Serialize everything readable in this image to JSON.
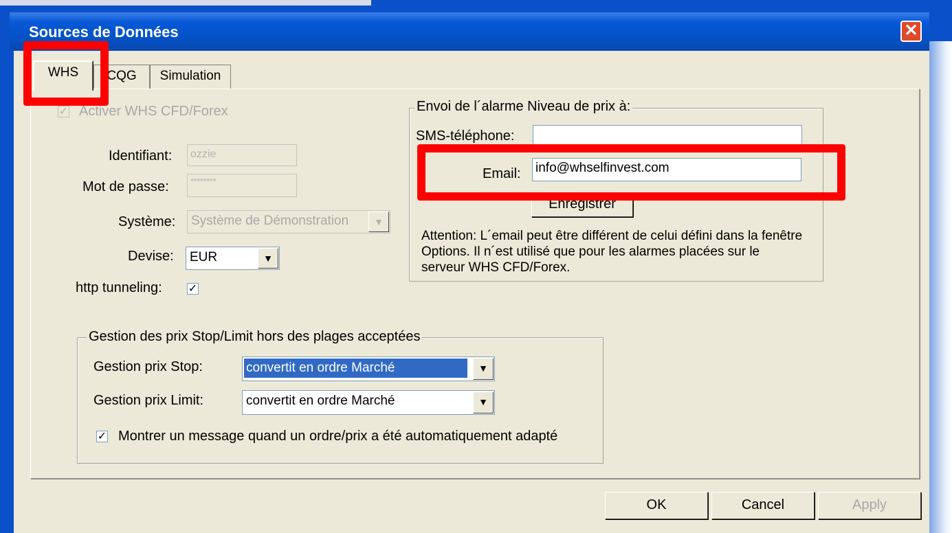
{
  "window": {
    "title": "Sources de Données",
    "close_glyph": "✕"
  },
  "tabs": [
    {
      "label": "WHS",
      "active": true
    },
    {
      "label": "CQG",
      "active": false
    },
    {
      "label": "Simulation",
      "active": false
    }
  ],
  "whs": {
    "activate_label": "Activer WHS CFD/Forex",
    "activate_checked": true,
    "identifiant_label": "Identifiant:",
    "identifiant_value": "ozzie",
    "password_label": "Mot de passe:",
    "password_value": "********",
    "systeme_label": "Système:",
    "systeme_value": "Système de Démonstration",
    "devise_label": "Devise:",
    "devise_value": "EUR",
    "http_label": "http tunneling:",
    "http_checked": true
  },
  "alarm": {
    "legend": "Envoi de l´alarme Niveau de prix à:",
    "sms_label": "SMS-téléphone:",
    "sms_value": "",
    "email_label": "Email:",
    "email_value": "info@whselfinvest.com",
    "save_label": "Enregistrer",
    "note": "Attention: L´email peut être différent de celui défini dans la fenêtre Options. Il n´est utilisé que pour les alarmes placées sur le serveur WHS CFD/Forex."
  },
  "stoplimit": {
    "legend": "Gestion des prix Stop/Limit hors des plages acceptées",
    "stop_label": "Gestion prix Stop:",
    "stop_value": "convertit en ordre Marché",
    "limit_label": "Gestion prix Limit:",
    "limit_value": "convertit en ordre Marché",
    "message_label": "Montrer un message quand un ordre/prix a été automatiquement adapté",
    "message_checked": true
  },
  "buttons": {
    "ok": "OK",
    "cancel": "Cancel",
    "apply": "Apply"
  },
  "glyphs": {
    "check": "✓",
    "dropdown": "▼"
  },
  "colors": {
    "titlebar": "#0451c4",
    "highlight": "#ff0000",
    "selection": "#316ac5"
  }
}
